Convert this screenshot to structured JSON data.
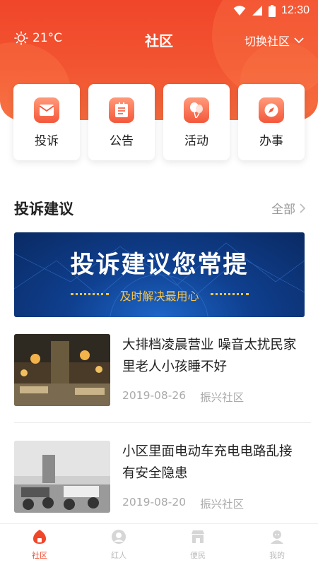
{
  "status_bar": {
    "time": "12:30"
  },
  "header": {
    "title": "社区",
    "temperature": "21°C",
    "switch_label": "切换社区"
  },
  "quick_actions": [
    {
      "label": "投诉",
      "icon": "mail-icon"
    },
    {
      "label": "公告",
      "icon": "notice-icon"
    },
    {
      "label": "活动",
      "icon": "balloon-icon"
    },
    {
      "label": "办事",
      "icon": "compass-icon"
    }
  ],
  "section": {
    "title": "投诉建议",
    "more_label": "全部"
  },
  "banner": {
    "title": "投诉建议您常提",
    "subtitle": "及时解决最用心"
  },
  "news": [
    {
      "title": "大排档凌晨营业 噪音太扰民家里老人小孩睡不好",
      "date": "2019-08-26",
      "community": "振兴社区"
    },
    {
      "title": "小区里面电动车充电电路乱接  有安全隐患",
      "date": "2019-08-20",
      "community": "振兴社区"
    }
  ],
  "tabs": [
    {
      "label": "社区",
      "icon": "community-home-icon",
      "active": true
    },
    {
      "label": "红人",
      "icon": "person-icon",
      "active": false
    },
    {
      "label": "便民",
      "icon": "shop-icon",
      "active": false
    },
    {
      "label": "我的",
      "icon": "profile-icon",
      "active": false
    }
  ],
  "colors": {
    "primary": "#f0462a",
    "banner_bg": "#0f3f8e",
    "banner_accent": "#f6c54a"
  }
}
